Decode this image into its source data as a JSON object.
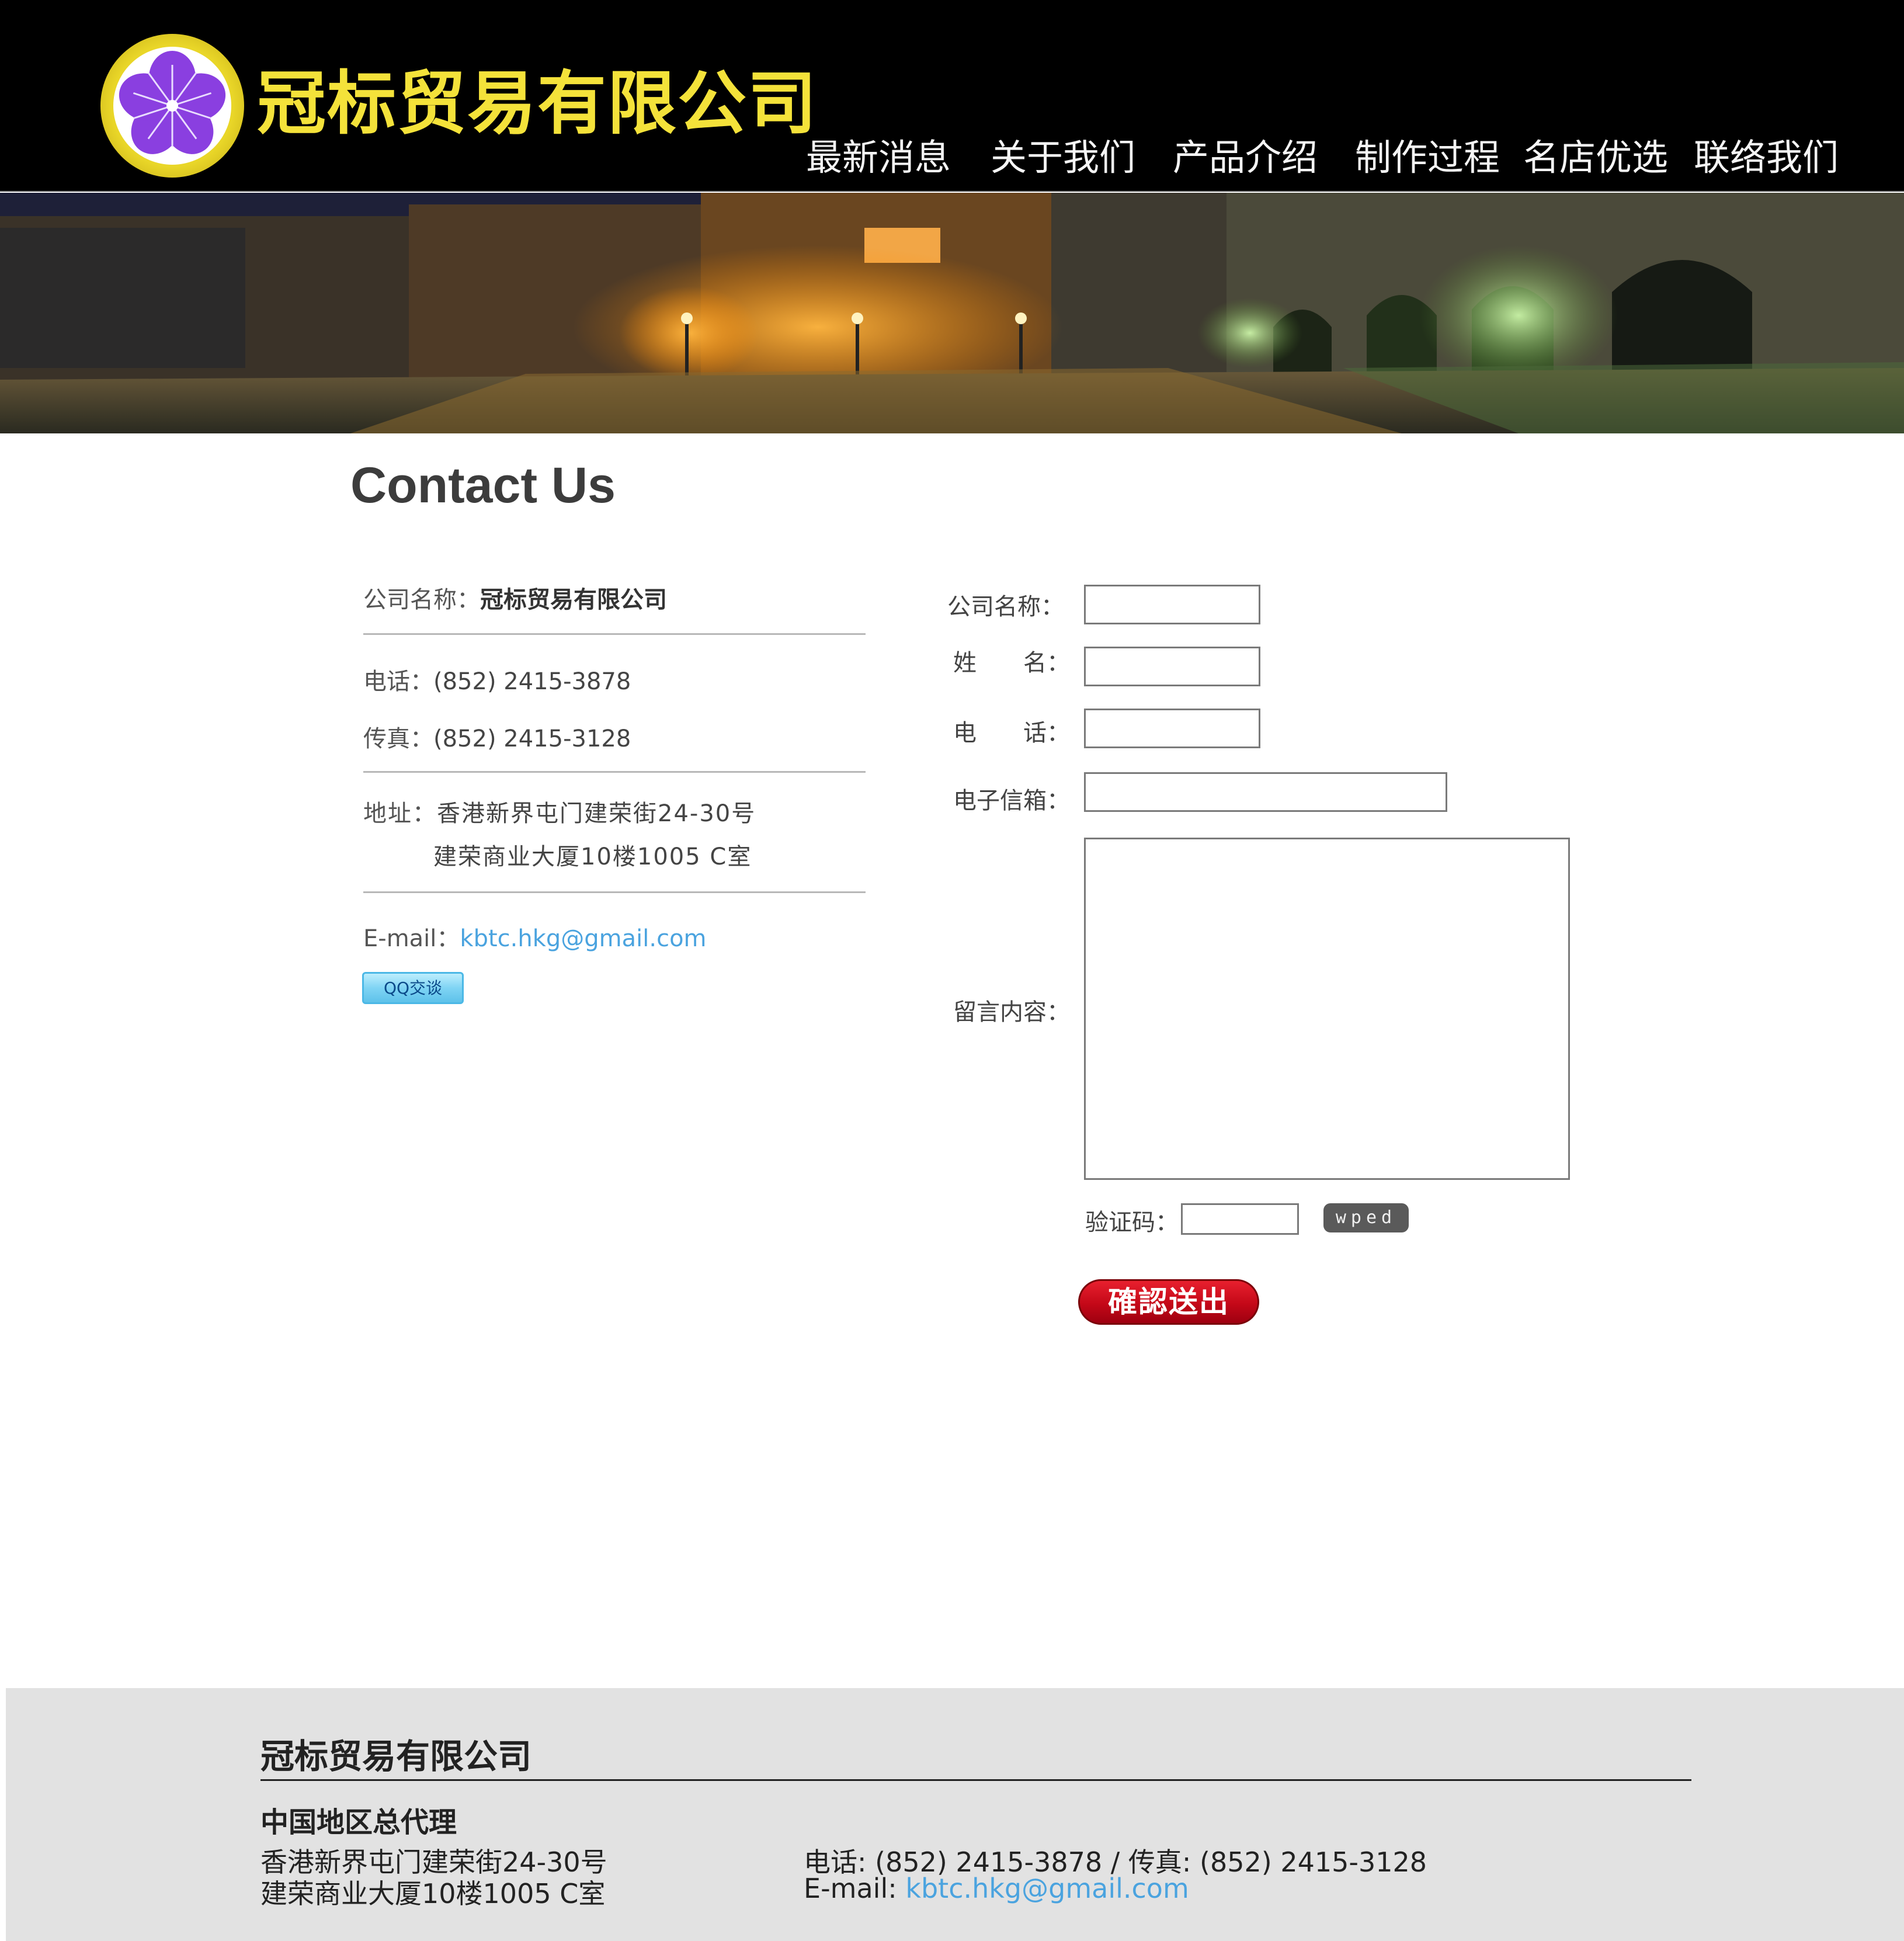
{
  "header": {
    "company_name": "冠标贸易有限公司",
    "nav": [
      "最新消息",
      "关于我们",
      "产品介绍",
      "制作过程",
      "名店优选",
      "联络我们"
    ]
  },
  "page": {
    "title": "Contact Us"
  },
  "contact_info": {
    "company_label": "公司名称：",
    "company_value": "冠标贸易有限公司",
    "phone_label": "电话：",
    "phone_value": "(852) 2415-3878",
    "fax_label": "传真：",
    "fax_value": "(852) 2415-3128",
    "address_label": "地址：",
    "address_line1": "香港新界屯门建荣街24-30号",
    "address_line2": "建荣商业大厦10楼1005 C室",
    "email_label": "E-mail：",
    "email_value": "kbtc.hkg@gmail.com",
    "qq_button": "QQ交谈"
  },
  "form": {
    "company_label": "公司名称：",
    "name_label": "姓　　名：",
    "phone_label": "电　　话：",
    "email_label": "电子信箱：",
    "message_label": "留言内容：",
    "captcha_label": "验证码：",
    "captcha_code": "wped",
    "submit_label": "確認送出",
    "company_value": "",
    "name_value": "",
    "phone_value": "",
    "email_value": "",
    "message_value": "",
    "captcha_value": ""
  },
  "footer": {
    "company_name": "冠标贸易有限公司",
    "subtitle": "中国地区总代理",
    "address_line1": "香港新界屯门建荣街24-30号",
    "address_line2": "建荣商业大厦10楼1005 C室",
    "phone_fax": "电话: (852) 2415-3878 / 传真: (852) 2415-3128",
    "email_label": "E-mail: ",
    "email_value": "kbtc.hkg@gmail.com"
  },
  "colors": {
    "header_bg": "#000000",
    "logo_text": "#f4e23a",
    "link": "#4aa3df",
    "submit": "#c40818",
    "footer_bg": "#e2e2e2"
  },
  "icons": {
    "logo": "purple-flower-logo-icon"
  }
}
